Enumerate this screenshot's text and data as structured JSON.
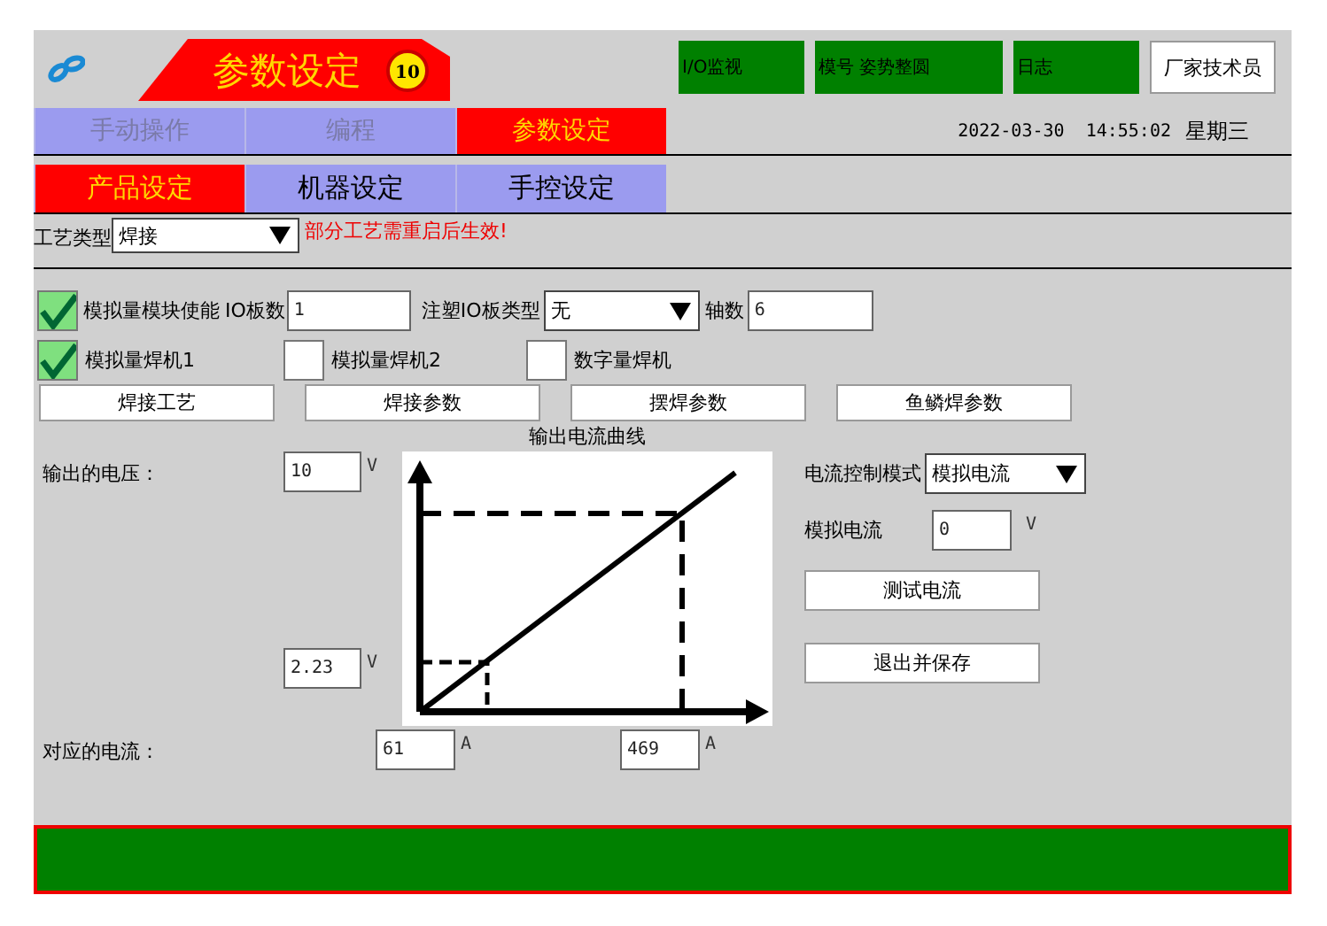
{
  "header": {
    "title": "参数设定",
    "badge": "10",
    "buttons": [
      {
        "label": "I/O监视",
        "kind": "status"
      },
      {
        "label": "模号 姿势整圆",
        "kind": "status"
      },
      {
        "label": "日志",
        "kind": "status"
      },
      {
        "label": "厂家技术员",
        "kind": "user"
      }
    ]
  },
  "main_tabs": [
    {
      "label": "手动操作",
      "selected": false,
      "disabled": true
    },
    {
      "label": "编程",
      "selected": false,
      "disabled": true
    },
    {
      "label": "参数设定",
      "selected": true,
      "disabled": false
    }
  ],
  "datetime": "2022-03-30  14:55:02",
  "weekday": "星期三",
  "sub_tabs": [
    {
      "label": "产品设定",
      "selected": true
    },
    {
      "label": "机器设定",
      "selected": false
    },
    {
      "label": "手控设定",
      "selected": false
    }
  ],
  "process_type": {
    "label": "工艺类型",
    "value": "焊接",
    "warning": "部分工艺需重启后生效!"
  },
  "analog_module": {
    "label": "模拟量模块使能",
    "checked": true
  },
  "io_boards": {
    "label": "IO板数",
    "value": "1"
  },
  "io_board_type": {
    "label": "注塑IO板类型",
    "value": "无"
  },
  "axes": {
    "label": "轴数",
    "value": "6"
  },
  "welders": [
    {
      "label": "模拟量焊机1",
      "checked": true
    },
    {
      "label": "模拟量焊机2",
      "checked": false
    },
    {
      "label": "数字量焊机",
      "checked": false
    }
  ],
  "param_buttons": [
    "焊接工艺",
    "焊接参数",
    "摆焊参数",
    "鱼鳞焊参数"
  ],
  "curve": {
    "title": "输出电流曲线",
    "voltage_label": "输出的电压：",
    "voltage_high": {
      "value": "10",
      "unit": "V"
    },
    "voltage_low": {
      "value": "2.23",
      "unit": "V"
    },
    "current_label": "对应的电流：",
    "current_low": {
      "value": "61",
      "unit": "A"
    },
    "current_high": {
      "value": "469",
      "unit": "A"
    }
  },
  "current_control": {
    "mode_label": "电流控制模式",
    "mode": "模拟电流",
    "analog_label": "模拟电流",
    "analog_value": "0",
    "analog_unit": "V",
    "buttons": [
      "测试电流",
      "退出并保存"
    ]
  }
}
